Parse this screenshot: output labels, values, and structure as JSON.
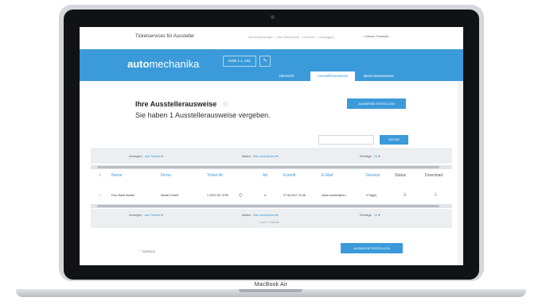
{
  "device": {
    "label": "MacBook Air"
  },
  "app": {
    "title": "Ticketservices für Aussteller",
    "top_links": [
      "Die Anmeldungen",
      "Ihre Warenkorb",
      "Deutsch",
      "Ausloggen"
    ],
    "user_label": "Messe Frankfurt"
  },
  "hero": {
    "logo_bold": "auto",
    "logo_light": "mechanika",
    "hall": "Halle 1.1, A01",
    "edit_symbol": "✎"
  },
  "tabs": [
    {
      "label": "Übersicht"
    },
    {
      "label": "Ausstellerausweise"
    },
    {
      "label": "Besucherausweise"
    }
  ],
  "main": {
    "heading": "Ihre Ausstellerausweise",
    "info_symbol": "ⓘ",
    "subheading": "Sie haben 1 Ausstellerausweise vergeben.",
    "create_button": "AUSWEISE ERSTELLEN",
    "search_placeholder": "",
    "search_button": "SUCHE"
  },
  "filters": {
    "show_label": "Anzeigen",
    "show_value": "alle Tickets",
    "action_label": "Aktion",
    "action_value": "bitte auswählen",
    "entries_label": "Einträge",
    "entries_value": "10"
  },
  "table": {
    "columns": [
      "Name",
      "Firma",
      "Ticket-Nr.",
      "Art",
      "Erstellt",
      "E-Mail",
      "Genutzt",
      "Status",
      "Download"
    ],
    "rows": [
      {
        "name": "Frau Marie Muster",
        "firma": "Muster GmbH",
        "ticket": "1 2224 267 3750",
        "art": "●",
        "erstellt": "27.06.2017 11:08",
        "email": "marie.muster@mu…",
        "genutzt": "0 Tag(e)"
      }
    ]
  },
  "footer": {
    "count": "1 von 1 Tickets",
    "back": "ZURÜCK",
    "create_button": "AUSWEISE ERSTELLEN"
  },
  "colors": {
    "accent": "#3b9ad9",
    "filter_bg": "#eceff2"
  }
}
